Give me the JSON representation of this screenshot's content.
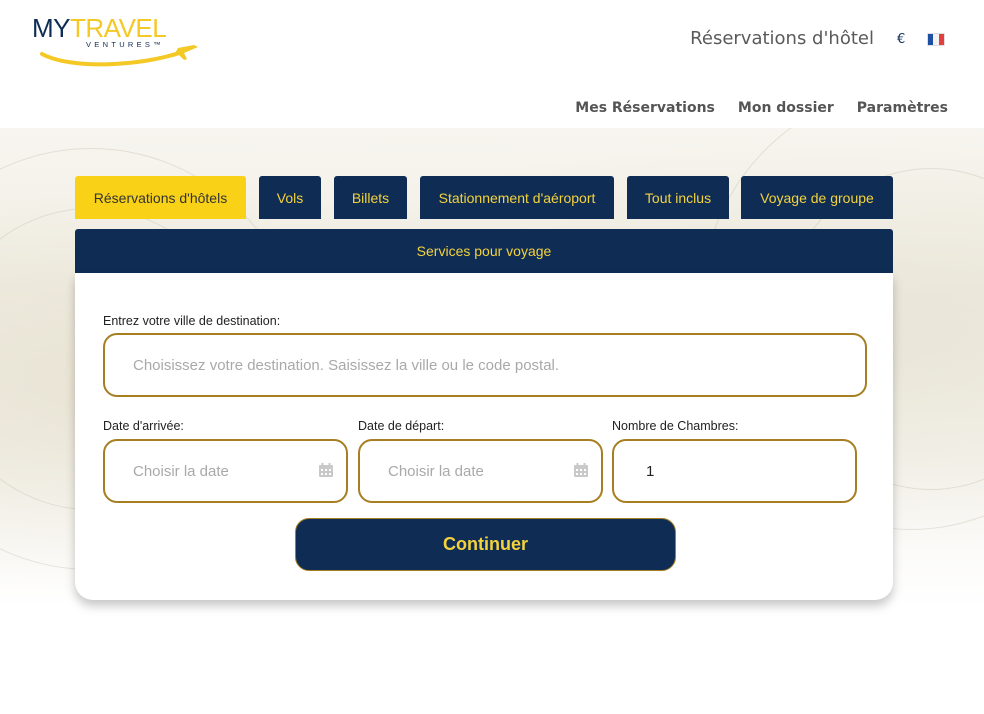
{
  "brand": {
    "logo_main_1": "MY",
    "logo_main_2": "TRAVEL",
    "logo_sub": "VENTURES™",
    "colors": {
      "navy": "#0f2d54",
      "gold": "#f4c825",
      "active_tab": "#f9d218",
      "input_border": "#a67f22"
    }
  },
  "header": {
    "title": "Réservations d'hôtel",
    "currency": "€",
    "language_flag_icon": "france-flag-icon"
  },
  "nav": {
    "items": [
      "Mes Réservations",
      "Mon dossier",
      "Paramètres"
    ]
  },
  "tabs": [
    {
      "label": "Réservations d'hôtels",
      "active": true
    },
    {
      "label": "Vols",
      "active": false
    },
    {
      "label": "Billets",
      "active": false
    },
    {
      "label": "Stationnement d'aéroport",
      "active": false
    },
    {
      "label": "Tout inclus",
      "active": false
    },
    {
      "label": "Voyage de groupe",
      "active": false
    }
  ],
  "panel": {
    "header": "Services pour voyage",
    "destination": {
      "label": "Entrez votre ville de destination:",
      "placeholder": "Choisissez votre destination. Saisissez la ville ou le code postal.",
      "value": ""
    },
    "arrival": {
      "label": "Date d'arrivée:",
      "placeholder": "Choisir la date",
      "icon": "calendar-icon"
    },
    "departure": {
      "label": "Date de départ:",
      "placeholder": "Choisir la date",
      "icon": "calendar-icon"
    },
    "rooms": {
      "label": "Nombre de Chambres:",
      "value": "1"
    },
    "continue_label": "Continuer"
  }
}
